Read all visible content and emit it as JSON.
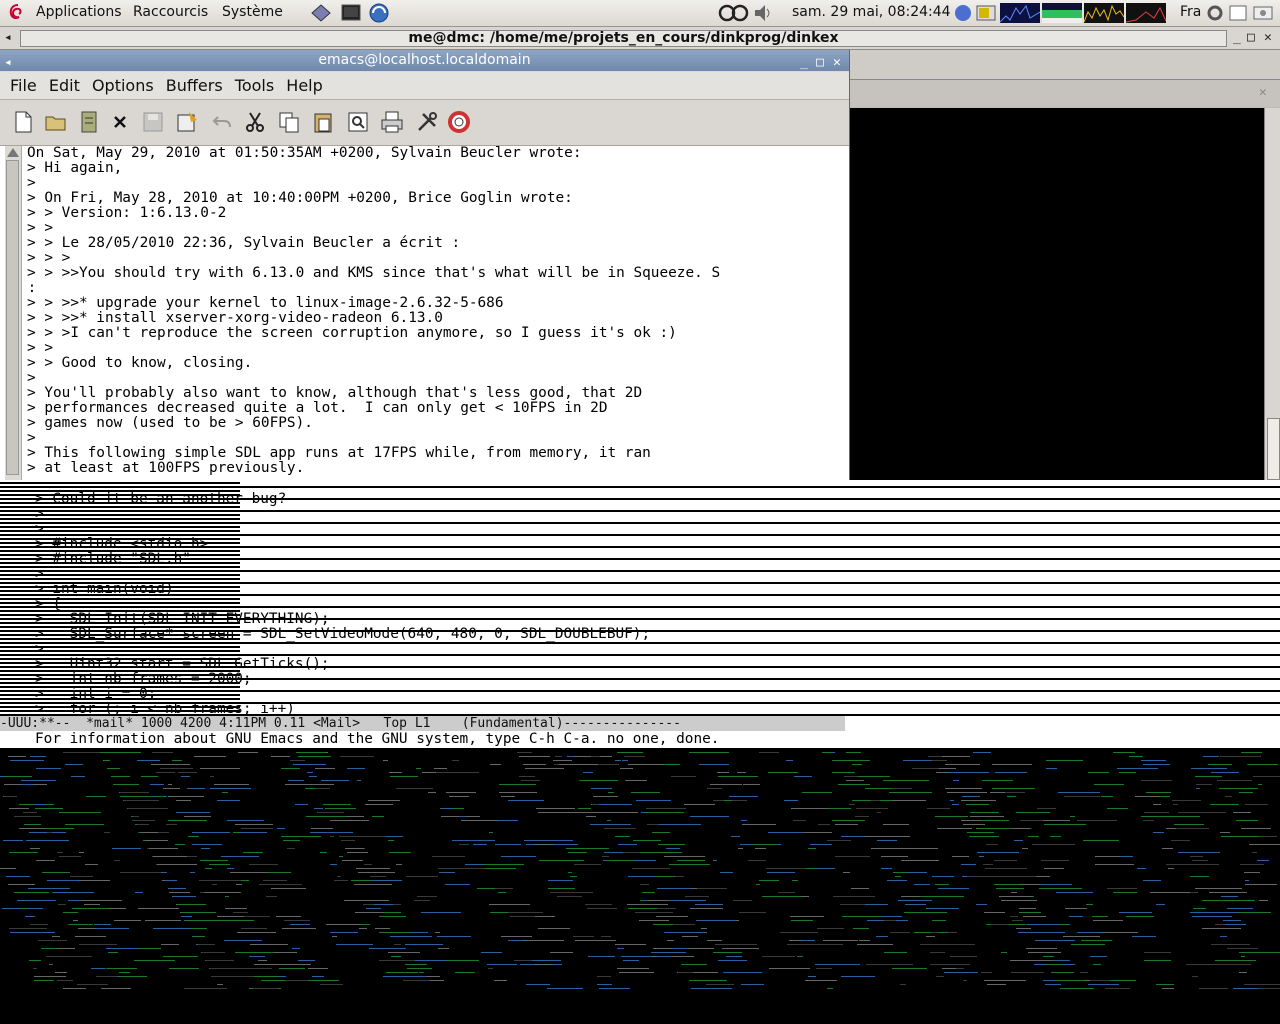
{
  "panel": {
    "applications": "Applications",
    "shortcuts": "Raccourcis",
    "system": "Système",
    "datetime": "sam. 29 mai, 08:24:44",
    "keyboard_layout": "Fra"
  },
  "terminal": {
    "title": "me@dmc: /home/me/projets_en_cours/dinkprog/dinkex"
  },
  "emacs": {
    "title": "emacs@localhost.localdomain",
    "menu": [
      "File",
      "Edit",
      "Options",
      "Buffers",
      "Tools",
      "Help"
    ],
    "lines": [
      "On Sat, May 29, 2010 at 01:50:35AM +0200, Sylvain Beucler wrote:",
      "> Hi again,",
      ">",
      "> On Fri, May 28, 2010 at 10:40:00PM +0200, Brice Goglin wrote:",
      "> > Version: 1:6.13.0-2",
      "> >",
      "> > Le 28/05/2010 22:36, Sylvain Beucler a écrit :",
      "> > >",
      "> > >>You should try with 6.13.0 and KMS since that's what will be in Squeeze. S",
      "o:",
      "> > >>* upgrade your kernel to linux-image-2.6.32-5-686",
      "> > >>* install xserver-xorg-video-radeon 6.13.0",
      "> > >I can't reproduce the screen corruption anymore, so I guess it's ok :)",
      "> >",
      "> > Good to know, closing.",
      ">",
      "> You'll probably also want to know, although that's less good, that 2D",
      "> performances decreased quite a lot.  I can only get < 10FPS in 2D",
      "> games now (used to be > 60FPS).",
      ">",
      "> This following simple SDL app runs at 17FPS while, from memory, it ran",
      "> at least at 100FPS previously."
    ],
    "glitched_lines": [
      "> Could it be an another bug?",
      ">",
      ">",
      "> #include <stdio.h>",
      "> #include \"SDL.h\"",
      ">",
      "> int main(void)",
      "> {",
      ">   SDL_Init(SDL_INIT_EVERYTHING);",
      ">   SDL_Surface* screen = SDL_SetVideoMode(640, 480, 0, SDL_DOUBLEBUF);",
      ">",
      ">   Uint32 start = SDL_GetTicks();",
      ">   int nb_frames = 2000;",
      ">   int i = 0;",
      ">   for (; i < nb_frames; i++)"
    ],
    "modeline": "-UUU:**--  *mail* 1000 4200 4:11PM 0.11 <Mail>   Top L1    (Fundamental)---------------",
    "echo_area": "For information about GNU Emacs and the GNU system, type C-h C-a. no one, done."
  }
}
